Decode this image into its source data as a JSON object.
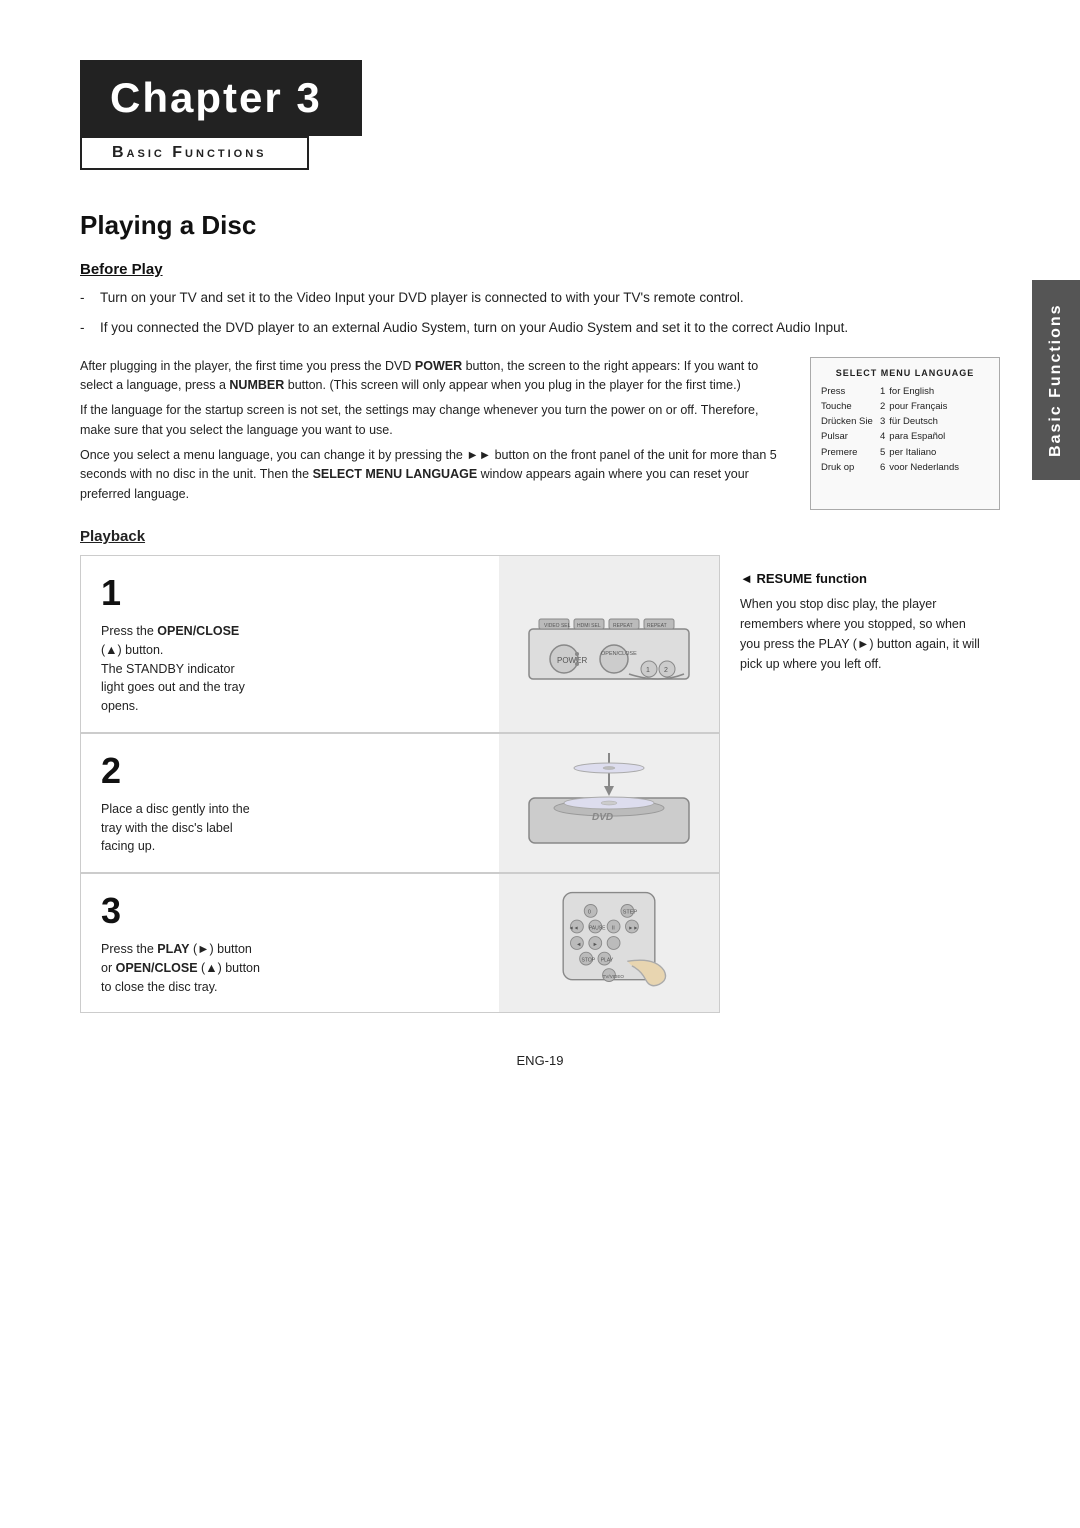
{
  "chapter": {
    "number": "Chapter 3",
    "subtitle": "Basic Functions"
  },
  "side_tab": "Basic Functions",
  "section": {
    "title": "Playing a Disc",
    "before_play": {
      "heading": "Before Play",
      "bullets": [
        "Turn on your TV and set it to the Video Input your DVD player is connected to with your TV's remote control.",
        "If you connected the DVD player to an external Audio System, turn on your Audio System and set it to the correct Audio Input."
      ]
    },
    "info_paragraphs": [
      "After plugging in the player, the first time you press the DVD POWER button, the screen to the right appears: If you want to select a language, press a NUMBER button. (This screen will only appear when you plug in the player for the first time.)",
      "If the language for the startup screen is not set, the settings may change whenever you turn the power on or off. Therefore, make sure that you select the language you want to use.",
      "Once you select a menu language, you can change it by pressing the ►► button on the front panel of the unit for more than 5 seconds with no disc in the unit. Then the SELECT MENU LANGUAGE window appears again where you can reset your preferred language."
    ],
    "select_menu_language": {
      "title": "SELECT MENU LANGUAGE",
      "rows": [
        {
          "key": "Press",
          "num": "1",
          "value": "for English"
        },
        {
          "key": "Touche",
          "num": "2",
          "value": "pour Français"
        },
        {
          "key": "Drücken Sie",
          "num": "3",
          "value": "für Deutsch"
        },
        {
          "key": "Pulsar",
          "num": "4",
          "value": "para Español"
        },
        {
          "key": "Premere",
          "num": "5",
          "value": "per Italiano"
        },
        {
          "key": "Druk op",
          "num": "6",
          "value": "voor Nederlands"
        }
      ]
    },
    "playback": {
      "heading": "Playback",
      "steps": [
        {
          "number": "1",
          "description": "Press the OPEN/CLOSE (▲) button.\nThe STANDBY indicator light goes out and the tray opens."
        },
        {
          "number": "2",
          "description": "Place a disc gently into the tray with the disc's label facing up."
        },
        {
          "number": "3",
          "description": "Press the PLAY (►) button or OPEN/CLOSE (▲) button to close the disc tray."
        }
      ],
      "resume": {
        "title": "RESUME function",
        "description": "When you stop disc play, the player remembers where you stopped, so when you press the PLAY (►) button again, it will pick up where you left off."
      }
    }
  },
  "page_number": "ENG-19"
}
